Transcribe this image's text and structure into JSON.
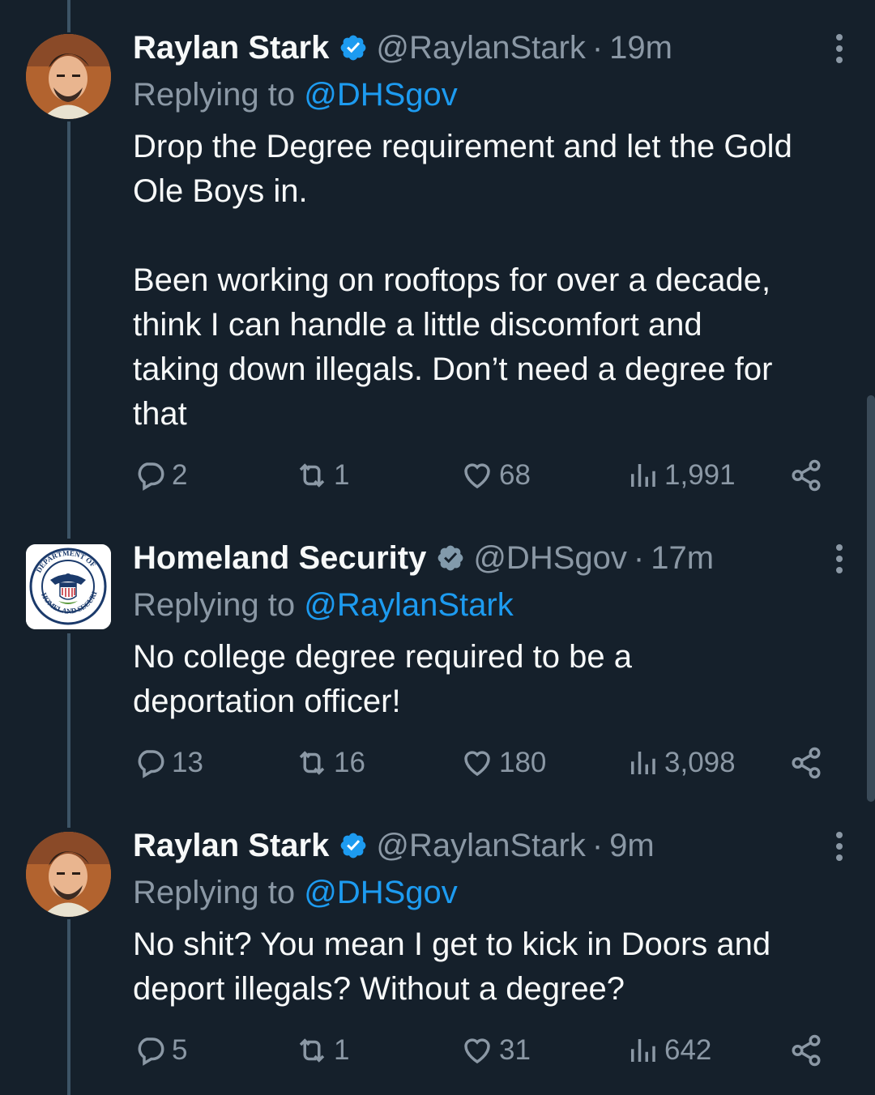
{
  "tweets": [
    {
      "name": "Raylan Stark",
      "handle": "@RaylanStark",
      "time": "19m",
      "replying_prefix": "Replying to ",
      "replying_to": "@DHSgov",
      "text": "Drop the Degree requirement and let the Gold\nOle Boys in.\n\nBeen working on rooftops for over a decade,\nthink I can handle a little discomfort and\ntaking down illegals. Don’t need a degree for\nthat",
      "replies": "2",
      "retweets": "1",
      "likes": "68",
      "views": "1,991",
      "avatar": "profile-photo",
      "badge": "blue-verified-icon"
    },
    {
      "name": "Homeland Security",
      "handle": "@DHSgov",
      "time": "17m",
      "replying_prefix": "Replying to ",
      "replying_to": "@RaylanStark",
      "text": "No college degree required to be a\ndeportation officer!",
      "replies": "13",
      "retweets": "16",
      "likes": "180",
      "views": "3,098",
      "avatar": "dhs-seal",
      "badge": "gray-government-verified-icon"
    },
    {
      "name": "Raylan Stark",
      "handle": "@RaylanStark",
      "time": "9m",
      "replying_prefix": "Replying to ",
      "replying_to": "@DHSgov",
      "text": "No shit? You mean I get to kick in Doors and\ndeport illegals? Without a degree?",
      "replies": "5",
      "retweets": "1",
      "likes": "31",
      "views": "642",
      "avatar": "profile-photo",
      "badge": "blue-verified-icon"
    }
  ],
  "seal_text": {
    "top": "DEPARTMENT OF",
    "bottom": "HOMELAND SECURITY",
    "left": "U.S."
  },
  "colors": {
    "background": "#15202b",
    "text": "#f7f9f9",
    "secondary": "#8b98a5",
    "link": "#1d9bf0",
    "thread_line": "#3d5466"
  }
}
